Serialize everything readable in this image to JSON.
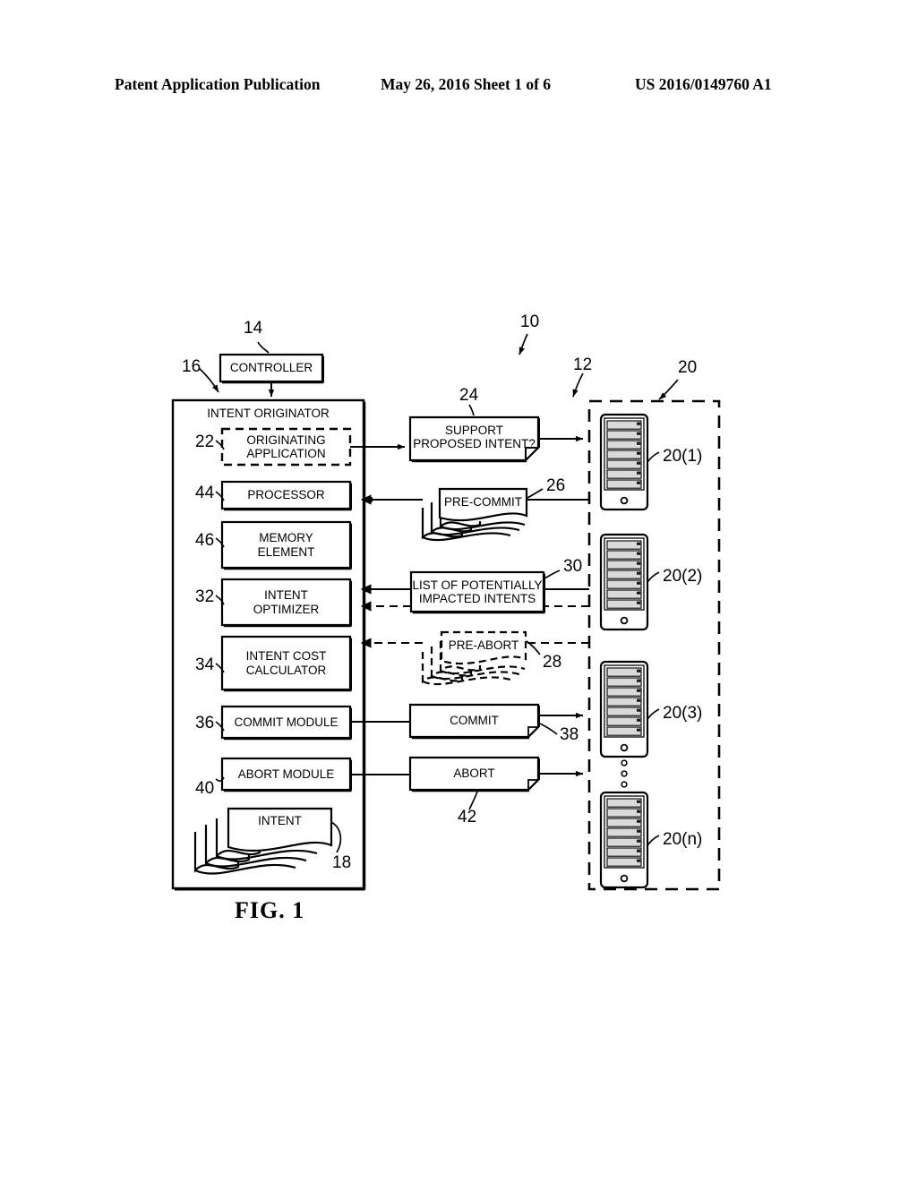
{
  "header": {
    "left": "Patent Application Publication",
    "middle": "May 26, 2016  Sheet 1 of 6",
    "right": "US 2016/0149760 A1"
  },
  "figure": {
    "caption": "FIG. 1",
    "system_ref": "10",
    "network_ref": "12"
  },
  "controller": {
    "label": "CONTROLLER",
    "ref": "14"
  },
  "intent_originator": {
    "title": "INTENT ORIGINATOR",
    "ref": "16",
    "modules": [
      {
        "label": "ORIGINATING\nAPPLICATION",
        "line1": "ORIGINATING",
        "line2": "APPLICATION",
        "ref": "22",
        "style": "dashed"
      },
      {
        "label": "PROCESSOR",
        "line1": "PROCESSOR",
        "line2": "",
        "ref": "44",
        "style": "solid"
      },
      {
        "label": "MEMORY ELEMENT",
        "line1": "MEMORY",
        "line2": "ELEMENT",
        "ref": "46",
        "style": "solid"
      },
      {
        "label": "INTENT OPTIMIZER",
        "line1": "INTENT",
        "line2": "OPTIMIZER",
        "ref": "32",
        "style": "solid"
      },
      {
        "label": "INTENT COST CALCULATOR",
        "line1": "INTENT COST",
        "line2": "CALCULATOR",
        "ref": "34",
        "style": "solid"
      },
      {
        "label": "COMMIT MODULE",
        "line1": "COMMIT MODULE",
        "line2": "",
        "ref": "36",
        "style": "solid"
      },
      {
        "label": "ABORT MODULE",
        "line1": "ABORT MODULE",
        "line2": "",
        "ref": "40",
        "style": "solid"
      }
    ],
    "intent_stack": {
      "label": "INTENT",
      "ref": "18"
    }
  },
  "messages": [
    {
      "label": "SUPPORT PROPOSED INTENT?",
      "line1": "SUPPORT",
      "line2": "PROPOSED INTENT?",
      "ref": "24",
      "shape": "document-folded",
      "direction": "right"
    },
    {
      "label": "PRE-COMMIT",
      "line1": "PRE-COMMIT",
      "line2": "",
      "ref": "26",
      "shape": "document-stack-wavy",
      "direction": "left"
    },
    {
      "label": "LIST OF POTENTIALLY IMPACTED INTENTS",
      "line1": "LIST OF POTENTIALLY",
      "line2": "IMPACTED INTENTS",
      "ref": "30",
      "shape": "rect",
      "direction": "left"
    },
    {
      "label": "PRE-ABORT",
      "line1": "PRE-ABORT",
      "line2": "",
      "ref": "28",
      "shape": "document-stack-wavy-dashed",
      "direction": "left"
    },
    {
      "label": "COMMIT",
      "line1": "COMMIT",
      "line2": "",
      "ref": "38",
      "shape": "document-folded",
      "direction": "right"
    },
    {
      "label": "ABORT",
      "line1": "ABORT",
      "line2": "",
      "ref": "42",
      "shape": "document-folded",
      "direction": "right"
    }
  ],
  "network_elements": {
    "group_ref": "20",
    "nodes": [
      {
        "ref": "20(1)"
      },
      {
        "ref": "20(2)"
      },
      {
        "ref": "20(3)"
      },
      {
        "ref": "20(n)"
      }
    ],
    "ellipsis": "⋮"
  },
  "colors": {
    "ink": "#000000",
    "paper": "#ffffff",
    "bay_fill": "#d9d9d9",
    "bay_led": "#1a1a1a"
  }
}
